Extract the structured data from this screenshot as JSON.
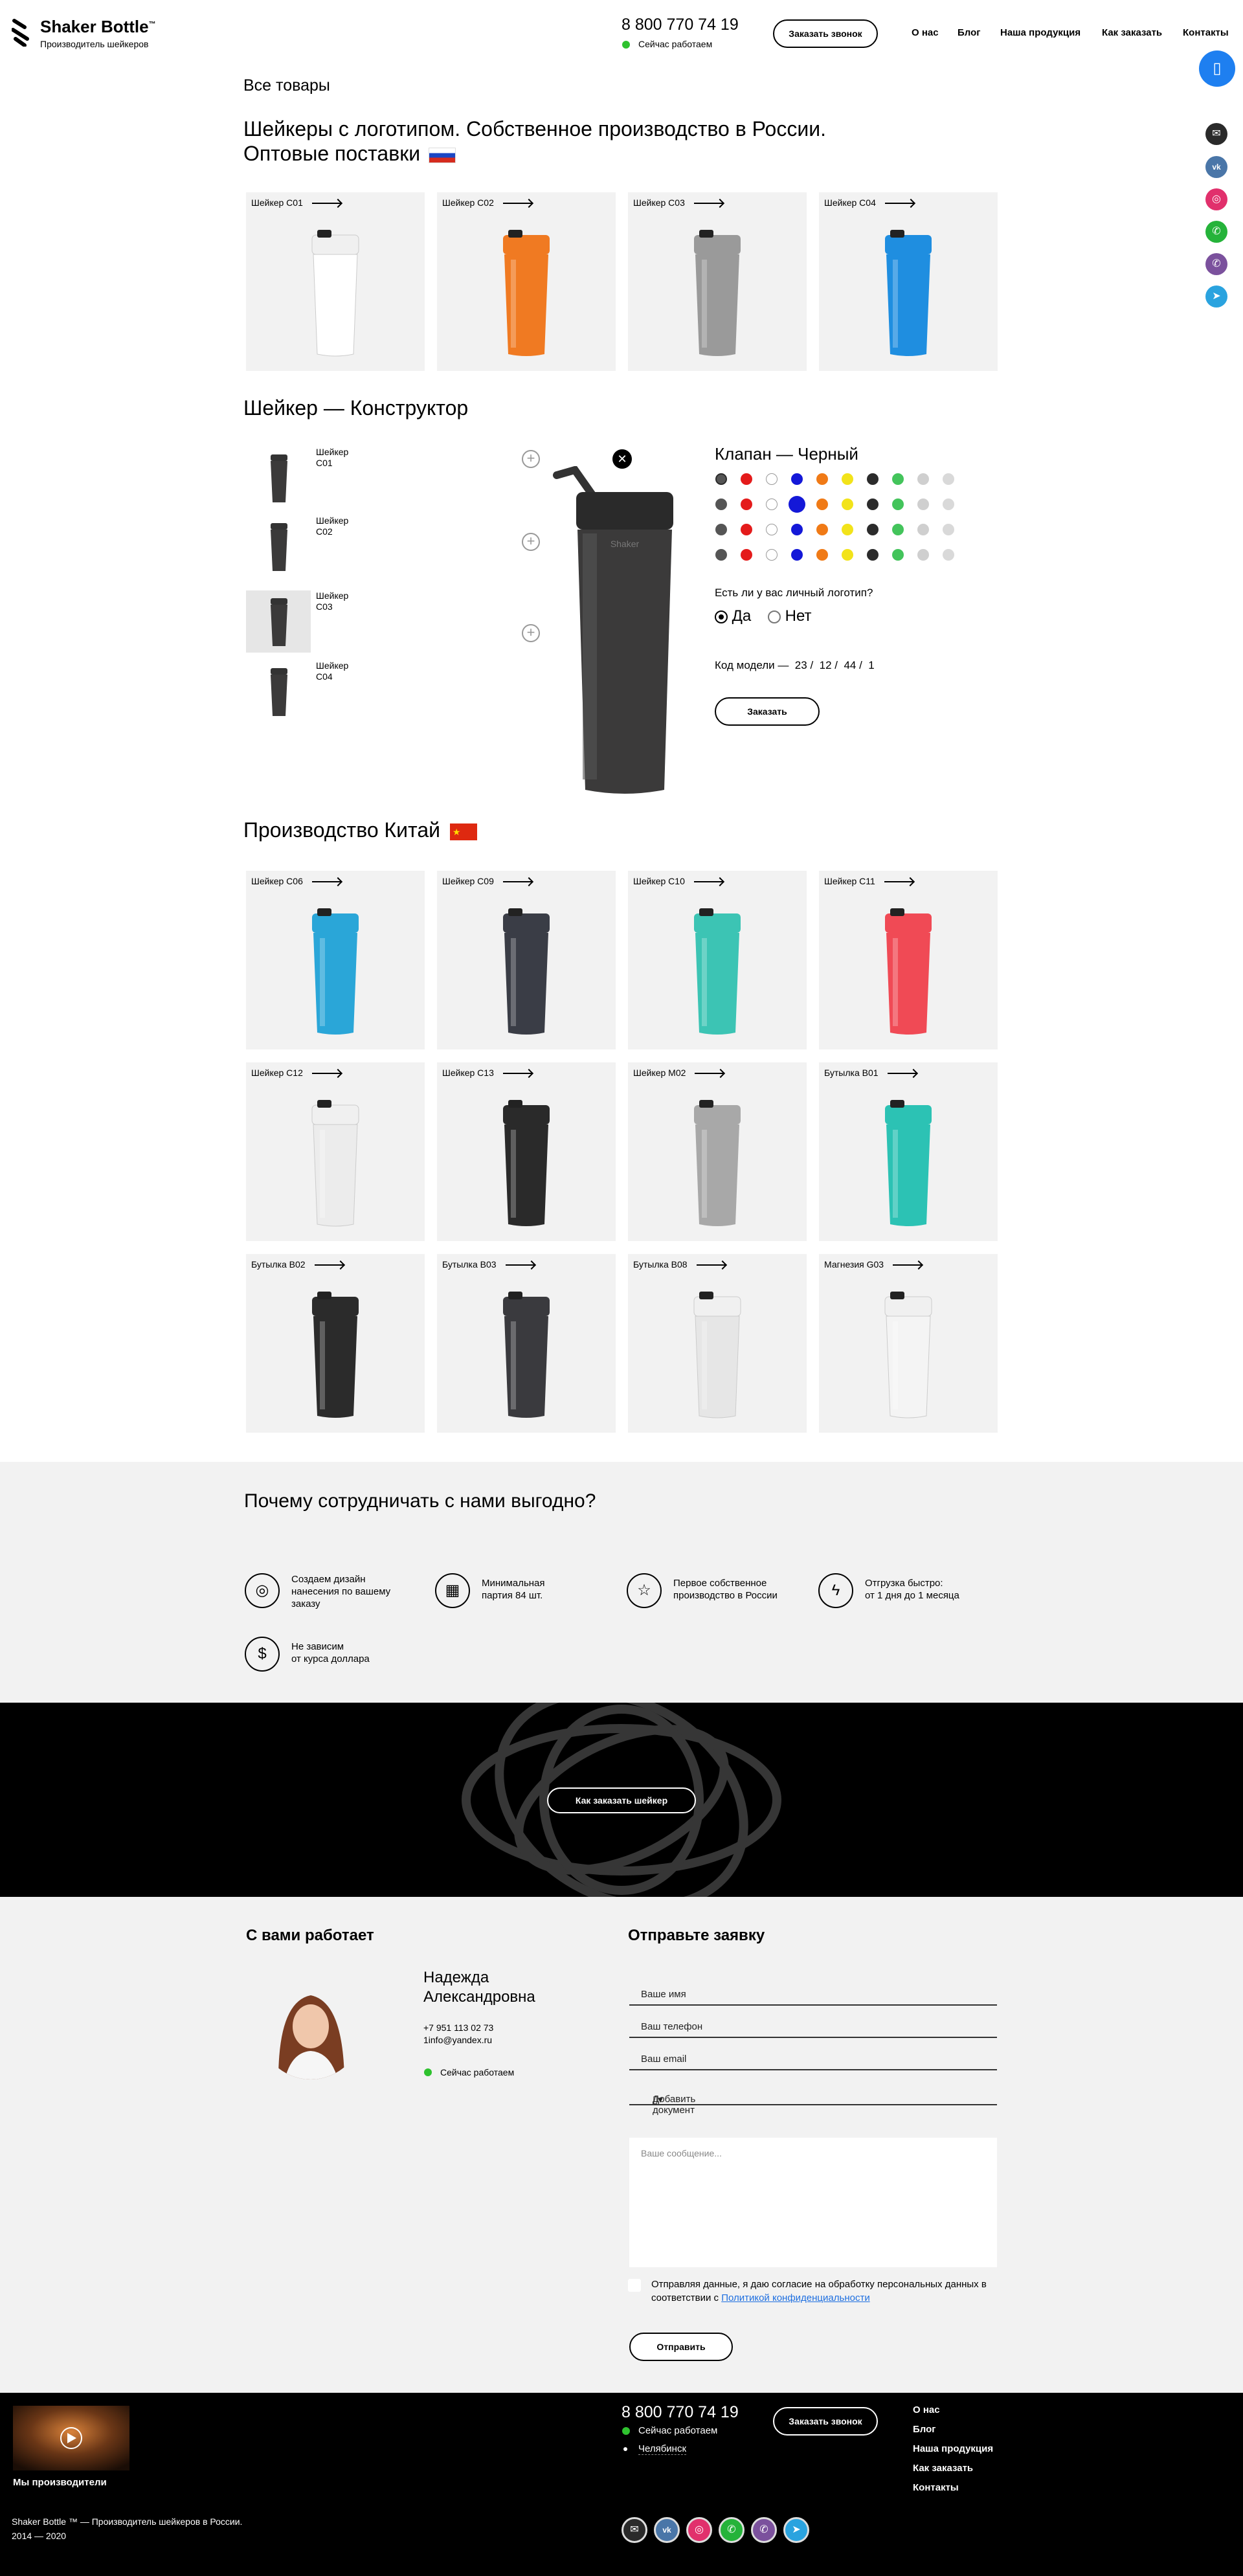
{
  "header": {
    "logo_title": "Shaker Bottle",
    "logo_tm": "™",
    "logo_subtitle": "Производитель шейкеров",
    "phone": "8 800 770 74 19",
    "status": "Сейчас работаем",
    "callback_button": "Заказать звонок",
    "nav": [
      "О нас",
      "Блог",
      "Наша продукция",
      "Как заказать",
      "Контакты"
    ]
  },
  "breadcrumb": "Все товары",
  "section_logo": {
    "title_line1": "Шейкеры с логотипом. Собственное производство в России.",
    "title_line2": "Оптовые поставки",
    "products": [
      {
        "label": "Шейкер C01",
        "color": "#ffffff"
      },
      {
        "label": "Шейкер C02",
        "color": "#f07a22"
      },
      {
        "label": "Шейкер C03",
        "color": "#9a9a9a"
      },
      {
        "label": "Шейкер C04",
        "color": "#1f8ee0"
      }
    ]
  },
  "constructor": {
    "title": "Шейкер — Конструктор",
    "models": [
      "Шейкер C01",
      "Шейкер C02",
      "Шейкер C03",
      "Шейкер C04"
    ],
    "valve_title": "Клапан — Черный",
    "palette": [
      "#555555",
      "#e41b1b",
      "#ffffff",
      "#1418d8",
      "#f07a16",
      "#f2e31a",
      "#2b2b2b",
      "#43c45b",
      "#cfcfcf",
      "#d9d9d9"
    ],
    "logo_question": "Есть ли у вас личный логотип?",
    "yes": "Да",
    "no": "Нет",
    "model_code_label": "Код модели —",
    "model_code": [
      "23",
      "12",
      "44",
      "1"
    ],
    "order_button": "Заказать"
  },
  "section_china": {
    "title": "Производство Китай",
    "products": [
      {
        "label": "Шейкер C06",
        "color": "#2aa6d8"
      },
      {
        "label": "Шейкер C09",
        "color": "#3a3d46"
      },
      {
        "label": "Шейкер C10",
        "color": "#3cc4b4"
      },
      {
        "label": "Шейкер C11",
        "color": "#f04a55"
      },
      {
        "label": "Шейкер C12",
        "color": "#ececec"
      },
      {
        "label": "Шейкер C13",
        "color": "#2a2a2a"
      },
      {
        "label": "Шейкер M02",
        "color": "#a8a8a8"
      },
      {
        "label": "Бутылка B01",
        "color": "#2cc2b4"
      },
      {
        "label": "Бутылка B02",
        "color": "#2b2b2b"
      },
      {
        "label": "Бутылка B03",
        "color": "#3a3a3e"
      },
      {
        "label": "Бутылка B08",
        "color": "#e6e6e6"
      },
      {
        "label": "Магнезия G03",
        "color": "#f4f4f4"
      }
    ]
  },
  "advantages": {
    "title": "Почему сотрудничать с нами выгодно?",
    "items": [
      {
        "icon": "target-icon",
        "line1": "Создаем дизайн",
        "line2": "нанесения по вашему",
        "line3": "заказу"
      },
      {
        "icon": "boxes-icon",
        "line1": "Минимальная",
        "line2": "партия 84 шт.",
        "line3": ""
      },
      {
        "icon": "star-icon",
        "line1": "Первое  собственное",
        "line2": "производство в России",
        "line3": ""
      },
      {
        "icon": "lightning-icon",
        "line1": "Отгрузка быстро:",
        "line2": "от 1 дня до 1 месяца",
        "line3": ""
      },
      {
        "icon": "dollar-icon",
        "line1": "Не зависим",
        "line2": "от курса доллара",
        "line3": ""
      }
    ]
  },
  "banner": {
    "button": "Как заказать шейкер"
  },
  "manager": {
    "title": "С вами работает",
    "name_line1": "Надежда",
    "name_line2": "Александровна",
    "phone": "+7 951 113 02 73",
    "email": "1info@yandex.ru",
    "status": "Сейчас работаем"
  },
  "form": {
    "title": "Отправьте заявку",
    "name": "Ваше имя",
    "phone": "Ваш телефон",
    "email": "Ваш email",
    "attach": "Добавить документ",
    "message_placeholder": "Ваше сообщение...",
    "consent_text": "Отправляя данные, я даю согласие на обработку персональных данных в соответствии с",
    "consent_link": "Политикой конфиденциальности",
    "submit": "Отправить"
  },
  "footer": {
    "video_caption": "Мы производители",
    "phone": "8 800 770 74 19",
    "status": "Сейчас работаем",
    "city": "Челябинск",
    "callback_button": "Заказать звонок",
    "nav": [
      "О нас",
      "Блог",
      "Наша продукция",
      "Как заказать",
      "Контакты"
    ],
    "copyright_line1": "Shaker Bottle ™ — Производитель шейкеров в России.",
    "copyright_line2": "2014 — 2020"
  },
  "colors": {
    "status_green": "#2fc22f",
    "accent_blue": "#1e7ff0",
    "link_blue": "#1e6fe0"
  },
  "social": [
    {
      "name": "email",
      "color": "#2a2a2a",
      "glyph": "✉"
    },
    {
      "name": "vk",
      "color": "#4a76a8",
      "glyph": "vk"
    },
    {
      "name": "instagram",
      "color": "#e1306c",
      "glyph": "◎"
    },
    {
      "name": "whatsapp",
      "color": "#25b33a",
      "glyph": "✆"
    },
    {
      "name": "viber",
      "color": "#7b519d",
      "glyph": "✆"
    },
    {
      "name": "telegram",
      "color": "#2aa3df",
      "glyph": "➤"
    }
  ]
}
